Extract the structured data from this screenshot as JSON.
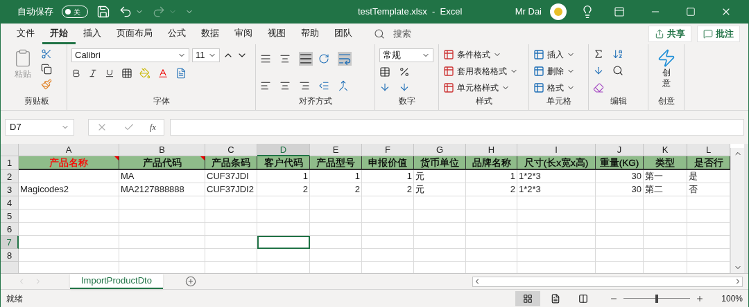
{
  "title_bar": {
    "autosave_label": "自动保存",
    "autosave_toggle": {
      "label": "关",
      "on": false
    },
    "title": "testTemplate.xlsx  -  Excel",
    "user": "Mr Dai"
  },
  "menu_tabs": [
    {
      "label": "文件",
      "selected": false
    },
    {
      "label": "开始",
      "selected": true
    },
    {
      "label": "插入",
      "selected": false
    },
    {
      "label": "页面布局",
      "selected": false
    },
    {
      "label": "公式",
      "selected": false
    },
    {
      "label": "数据",
      "selected": false
    },
    {
      "label": "审阅",
      "selected": false
    },
    {
      "label": "视图",
      "selected": false
    },
    {
      "label": "帮助",
      "selected": false
    },
    {
      "label": "团队",
      "selected": false
    }
  ],
  "search": {
    "placeholder": "搜索"
  },
  "share_button": "共享",
  "comment_button": "批注",
  "ribbon": {
    "clipboard": {
      "paste": "粘贴",
      "label": "剪贴板"
    },
    "font": {
      "font_name": "Calibri",
      "font_size": "11",
      "label": "字体"
    },
    "alignment": {
      "label": "对齐方式"
    },
    "number": {
      "format": "常规",
      "label": "数字"
    },
    "styles": {
      "items": [
        "条件格式",
        "套用表格格式",
        "单元格样式"
      ],
      "label": "样式"
    },
    "cells": {
      "items": [
        "插入",
        "删除",
        "格式"
      ],
      "label": "单元格"
    },
    "editing": {
      "label": "编辑"
    },
    "creative": {
      "button": "创意",
      "label": "创意"
    }
  },
  "formula_bar": {
    "name_box": "D7",
    "insert_function": "fx"
  },
  "sheet": {
    "columns": [
      {
        "letter": "A",
        "numeric": false,
        "selected": false
      },
      {
        "letter": "B",
        "numeric": false,
        "selected": false
      },
      {
        "letter": "C",
        "numeric": false,
        "selected": false
      },
      {
        "letter": "D",
        "numeric": true,
        "selected": true
      },
      {
        "letter": "E",
        "numeric": true,
        "selected": false
      },
      {
        "letter": "F",
        "numeric": true,
        "selected": false
      },
      {
        "letter": "G",
        "numeric": false,
        "selected": false
      },
      {
        "letter": "H",
        "numeric": true,
        "selected": false
      },
      {
        "letter": "I",
        "numeric": false,
        "selected": false
      },
      {
        "letter": "J",
        "numeric": true,
        "selected": false
      },
      {
        "letter": "K",
        "numeric": false,
        "selected": false
      },
      {
        "letter": "L",
        "numeric": false,
        "selected": false
      }
    ],
    "header_row": {
      "number": "1",
      "selected": false,
      "cells": [
        {
          "text": "产品名称",
          "color": "#ff0000",
          "comment": true
        },
        {
          "text": "产品代码",
          "color": "#000000",
          "comment": true
        },
        {
          "text": "产品条码",
          "color": "#000000",
          "comment": false
        },
        {
          "text": "客户代码",
          "color": "#000000",
          "comment": false
        },
        {
          "text": "产品型号",
          "color": "#000000",
          "comment": false
        },
        {
          "text": "申报价值",
          "color": "#000000",
          "comment": false
        },
        {
          "text": "货币单位",
          "color": "#000000",
          "comment": false
        },
        {
          "text": "品牌名称",
          "color": "#000000",
          "comment": false
        },
        {
          "text": "尺寸(长x宽x高)",
          "color": "#000000",
          "comment": false
        },
        {
          "text": "重量(KG)",
          "color": "#000000",
          "comment": false
        },
        {
          "text": "类型",
          "color": "#000000",
          "comment": false
        },
        {
          "text": "是否行",
          "color": "#000000",
          "comment": false
        }
      ]
    },
    "rows": [
      {
        "number": "2",
        "selected": false,
        "cells": [
          "",
          "MA",
          "CUF37JDI",
          "1",
          "1",
          "1",
          "元",
          "1",
          "1*2*3",
          "30",
          "第一",
          "是"
        ]
      },
      {
        "number": "3",
        "selected": false,
        "cells": [
          "Magicodes2",
          "MA2127888888",
          "CUF37JDI2",
          "2",
          "2",
          "2",
          "元",
          "2",
          "1*2*3",
          "30",
          "第二",
          "否"
        ]
      },
      {
        "number": "4",
        "selected": false,
        "cells": []
      },
      {
        "number": "5",
        "selected": false,
        "cells": []
      },
      {
        "number": "6",
        "selected": false,
        "cells": []
      },
      {
        "number": "7",
        "selected": true,
        "cells": []
      },
      {
        "number": "8",
        "selected": false,
        "cells": []
      }
    ]
  },
  "sheet_tabs": [
    {
      "label": "ImportProductDto",
      "selected": true
    }
  ],
  "status_bar": {
    "status": "就绪",
    "views": [
      {
        "kind": "normal",
        "selected": true
      },
      {
        "kind": "page_layout",
        "selected": false
      },
      {
        "kind": "page_break",
        "selected": false
      }
    ],
    "zoom": {
      "level": 0.5,
      "reading": "100%"
    }
  }
}
